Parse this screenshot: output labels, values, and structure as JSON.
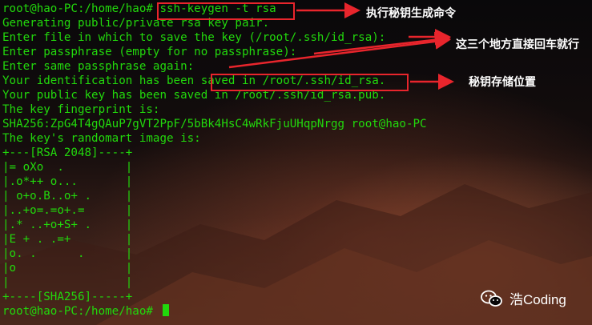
{
  "terminal": {
    "lines": [
      "root@hao-PC:/home/hao# ssh-keygen -t rsa",
      "Generating public/private rsa key pair.",
      "Enter file in which to save the key (/root/.ssh/id_rsa):",
      "Enter passphrase (empty for no passphrase):",
      "Enter same passphrase again:",
      "Your identification has been saved in /root/.ssh/id_rsa.",
      "Your public key has been saved in /root/.ssh/id_rsa.pub.",
      "The key fingerprint is:",
      "SHA256:ZpG4T4gQAuP7gVT2PpF/5bBk4HsC4wRkFjuUHqpNrgg root@hao-PC",
      "The key's randomart image is:",
      "+---[RSA 2048]----+",
      "|= oXo  .         |",
      "|.o*++ o...       |",
      "| o+o.B..o+ .     |",
      "|..+o=.=o+.=      |",
      "|.* ..+o+S+ .     |",
      "|E + . .=+        |",
      "|o. .      .      |",
      "|o                |",
      "|                 |",
      "+----[SHA256]-----+"
    ],
    "prompt": "root@hao-PC:/home/hao# "
  },
  "annotations": {
    "command_note": "执行秘钥生成命令",
    "enter_note": "这三个地方直接回车就行",
    "location_note": "秘钥存储位置"
  },
  "watermark": {
    "text": "浩Coding"
  },
  "colors": {
    "terminal_text": "#22d80c",
    "annotation_red": "#e8252c"
  }
}
